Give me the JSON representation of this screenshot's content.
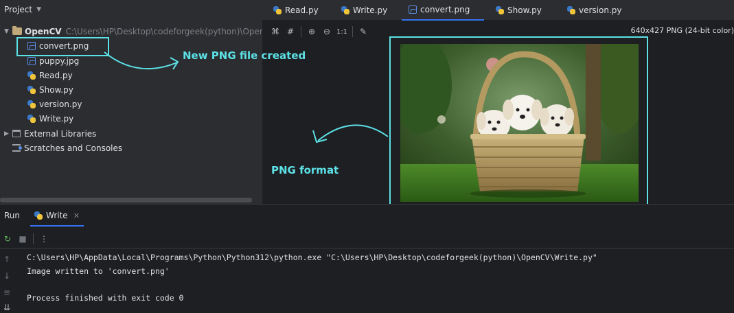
{
  "project": {
    "title": "Project",
    "root": {
      "name": "OpenCV",
      "path": "C:\\Users\\HP\\Desktop\\codeforgeek(python)\\OpenCV"
    },
    "files": [
      "convert.png",
      "puppy.jpg",
      "Read.py",
      "Show.py",
      "version.py",
      "Write.py"
    ],
    "external_libraries": "External Libraries",
    "scratches": "Scratches and Consoles"
  },
  "editor": {
    "tabs": [
      "Read.py",
      "Write.py",
      "convert.png",
      "Show.py",
      "version.py"
    ],
    "active_tab": "convert.png",
    "image_info": "640x427 PNG (24-bit color)",
    "zoom_label": "1:1"
  },
  "annotations": {
    "new_file": "New PNG file created",
    "png_format": "PNG format"
  },
  "run": {
    "title": "Run",
    "tab": "Write",
    "console": [
      "C:\\Users\\HP\\AppData\\Local\\Programs\\Python\\Python312\\python.exe \"C:\\Users\\HP\\Desktop\\codeforgeek(python)\\OpenCV\\Write.py\"",
      "Image written to 'convert.png'",
      "",
      "Process finished with exit code 0"
    ]
  },
  "colors": {
    "highlight": "#5ce1e6",
    "accent": "#3574f0",
    "panel": "#2b2d30",
    "editor": "#1e1f22"
  }
}
